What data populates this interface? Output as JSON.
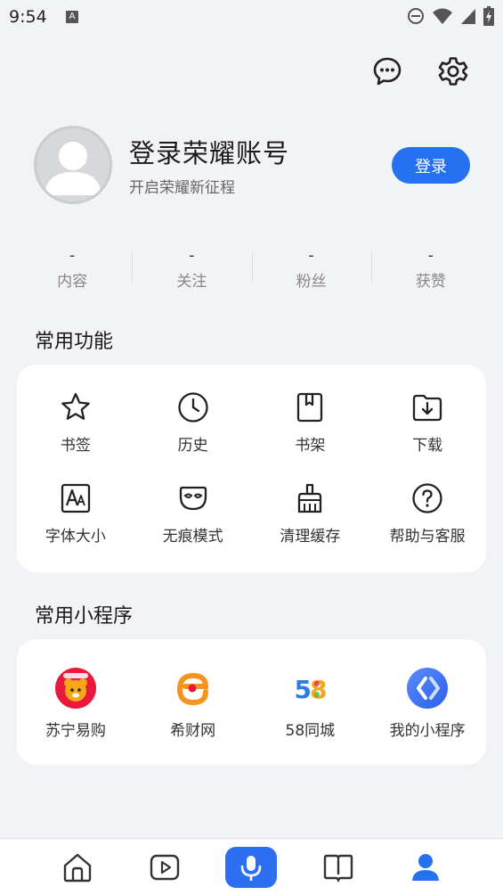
{
  "status_bar": {
    "time": "9:54",
    "a_glyph": "A"
  },
  "header_icons": [
    {
      "name": "message-icon"
    },
    {
      "name": "settings-icon"
    }
  ],
  "profile": {
    "title": "登录荣耀账号",
    "subtitle": "开启荣耀新征程",
    "login_button": "登录"
  },
  "stats": [
    {
      "value": "-",
      "label": "内容"
    },
    {
      "value": "-",
      "label": "关注"
    },
    {
      "value": "-",
      "label": "粉丝"
    },
    {
      "value": "-",
      "label": "获赞"
    }
  ],
  "common_functions": {
    "title": "常用功能",
    "items": [
      {
        "label": "书签",
        "icon": "bookmark-star-icon"
      },
      {
        "label": "历史",
        "icon": "history-clock-icon"
      },
      {
        "label": "书架",
        "icon": "bookshelf-icon"
      },
      {
        "label": "下载",
        "icon": "download-folder-icon"
      },
      {
        "label": "字体大小",
        "icon": "font-size-icon"
      },
      {
        "label": "无痕模式",
        "icon": "incognito-mask-icon"
      },
      {
        "label": "清理缓存",
        "icon": "clean-brush-icon"
      },
      {
        "label": "帮助与客服",
        "icon": "help-question-icon"
      }
    ]
  },
  "mini_programs": {
    "title": "常用小程序",
    "items": [
      {
        "label": "苏宁易购",
        "icon": "suning-logo-icon"
      },
      {
        "label": "希财网",
        "icon": "xicai-logo-icon"
      },
      {
        "label": "58同城",
        "icon": "58-logo-icon",
        "logo_text": "58"
      },
      {
        "label": "我的小程序",
        "icon": "my-miniprogram-icon"
      }
    ]
  },
  "bottom_nav": [
    {
      "name": "home-icon"
    },
    {
      "name": "video-play-icon"
    },
    {
      "name": "microphone-icon"
    },
    {
      "name": "novel-book-icon"
    },
    {
      "name": "profile-icon"
    }
  ],
  "colors": {
    "accent": "#2571ef",
    "background": "#f1f3f7",
    "card": "#ffffff"
  }
}
